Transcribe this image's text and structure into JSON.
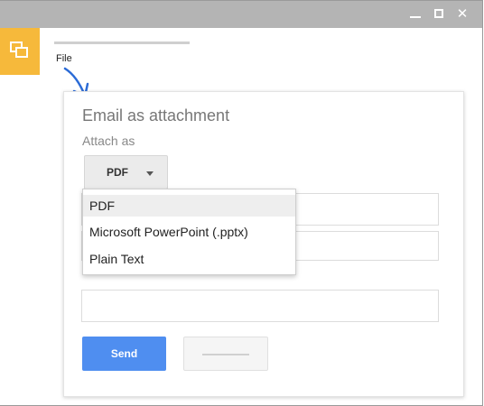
{
  "menubar": {
    "file_label": "File"
  },
  "dialog": {
    "title": "Email as attachment",
    "subtitle": "Attach as",
    "attach_selected": "PDF",
    "menu_items": [
      "PDF",
      "Microsoft PowerPoint (.pptx)",
      "Plain Text"
    ],
    "send_label": "Send"
  },
  "colors": {
    "accent": "#4f8ef0",
    "app_badge": "#f6b93b",
    "titlebar": "#b4b4b4",
    "arrow": "#2b6bd6"
  },
  "icons": [
    "minimize-icon",
    "maximize-icon",
    "close-icon",
    "app-icon",
    "annotation-arrow"
  ]
}
